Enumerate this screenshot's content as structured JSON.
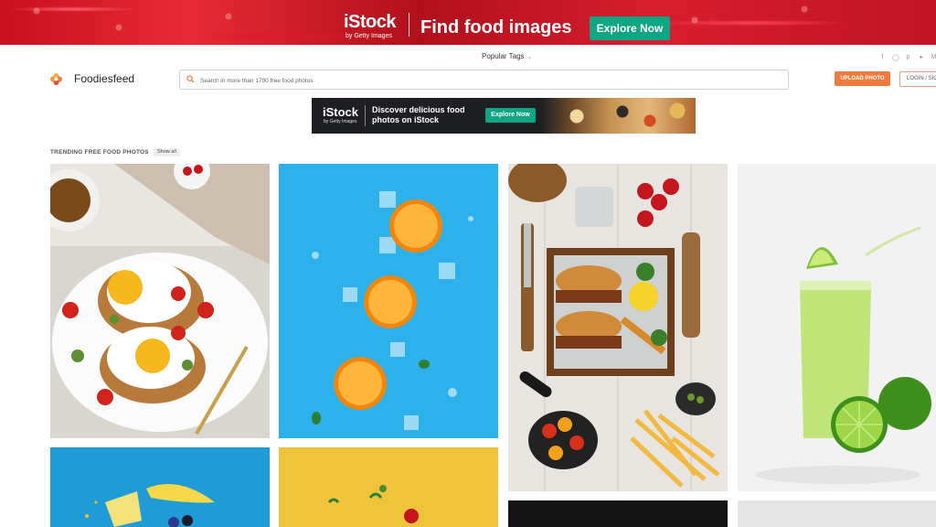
{
  "top_banner": {
    "brand": "iStock",
    "sub_brand": "by Getty Images",
    "headline": "Find food images",
    "cta": "Explore Now"
  },
  "header": {
    "popular_tags": "Popular Tags",
    "social_icons": [
      "facebook-icon",
      "instagram-icon",
      "pinterest-icon",
      "twitter-icon"
    ],
    "social_extra": "M",
    "logo_text": "Foodiesfeed",
    "search_placeholder": "Search in more than 1700 free food photos",
    "upload_label": "UPLOAD PHOTO",
    "login_label": "LOGIN / SIG"
  },
  "ad_banner": {
    "brand": "iStock",
    "sub_brand": "by Getty Images",
    "headline": "Discover delicious food photos on iStock",
    "cta": "Explore Now"
  },
  "trending": {
    "title": "TRENDING FREE FOOD PHOTOS",
    "show_all": "Show all"
  },
  "colors": {
    "accent_green": "#10a583",
    "upload_orange": "#f07a3e",
    "banner_red": "#c8101e"
  }
}
